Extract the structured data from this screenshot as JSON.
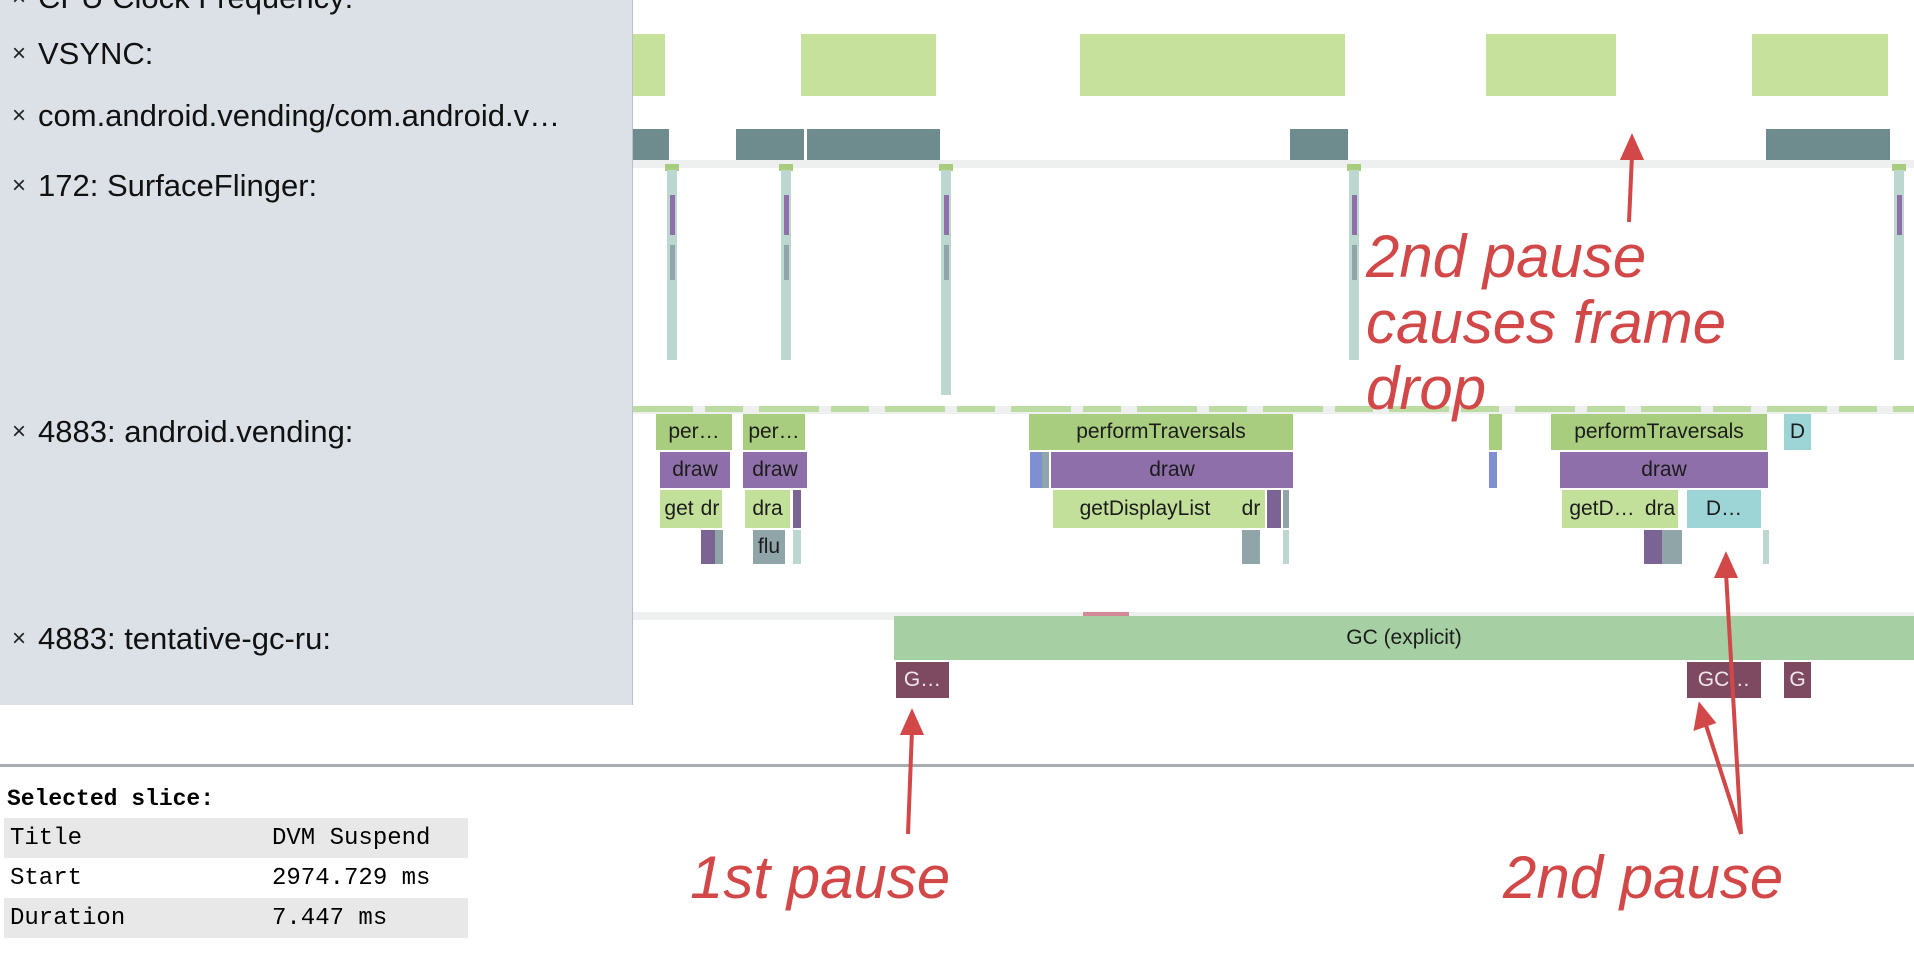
{
  "left_panel": {
    "rows": [
      {
        "close": "×",
        "label": "CPU Clock Frequency:"
      },
      {
        "close": "×",
        "label": "VSYNC:"
      },
      {
        "close": "×",
        "label": "com.android.vending/com.android.v…"
      },
      {
        "close": "×",
        "label": "172: SurfaceFlinger:"
      },
      {
        "close": "×",
        "label": "4883: android.vending:"
      },
      {
        "close": "×",
        "label": "4883: tentative-gc-ru:"
      }
    ]
  },
  "slices": {
    "per_1": "per…",
    "per_2": "per…",
    "perform_1": "performTraversals",
    "perform_2": "performTraversals",
    "d_small": "D",
    "draw_1": "draw",
    "draw_2": "draw",
    "draw_3": "draw",
    "draw_4": "draw",
    "get": "get",
    "dr_1": "dr",
    "dra_1": "dra",
    "get_display_list": "getDisplayList",
    "dr_2": "dr",
    "getd": "getD…",
    "dra_2": "dra",
    "d_cyan": "D…",
    "flu": "flu",
    "gc_explicit": "GC (explicit)",
    "g_1": "G…",
    "gc_2": "GC…",
    "g_3": "G"
  },
  "details": {
    "header": "Selected slice:",
    "rows": [
      {
        "key": "Title",
        "value": "DVM Suspend"
      },
      {
        "key": "Start",
        "value": "2974.729 ms"
      },
      {
        "key": "Duration",
        "value": "7.447 ms"
      }
    ]
  },
  "annotations": {
    "frame_drop": "2nd pause causes frame drop",
    "first_pause": "1st pause",
    "second_pause": "2nd pause"
  },
  "colors": {
    "annotation": "#d24848",
    "vsync": "#c5e19b",
    "gc": "#a6cfa3",
    "draw": "#8e6fa9",
    "perform_traversals": "#a9cd7e",
    "pause": "#7e4a62",
    "cyan": "#9dd4d6"
  }
}
